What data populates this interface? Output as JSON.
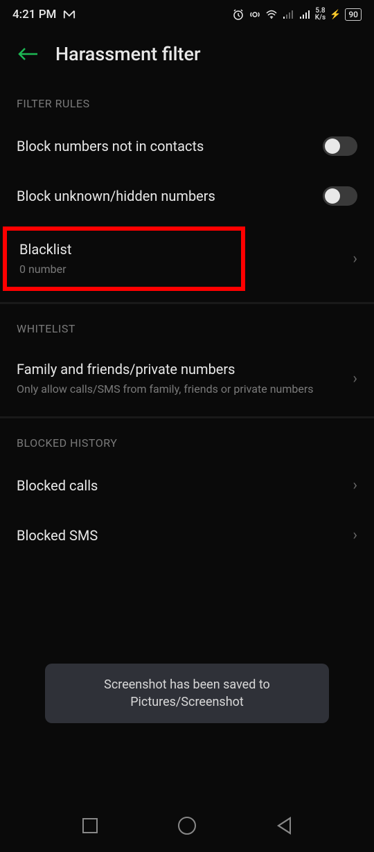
{
  "status_bar": {
    "time": "4:21 PM",
    "speed_value": "5.8",
    "speed_unit": "K/s",
    "battery": "90"
  },
  "header": {
    "title": "Harassment filter"
  },
  "sections": {
    "filter_rules": {
      "header": "FILTER RULES",
      "block_not_in_contacts": "Block numbers not in contacts",
      "block_unknown": "Block unknown/hidden numbers",
      "blacklist_title": "Blacklist",
      "blacklist_subtitle": "0 number"
    },
    "whitelist": {
      "header": "WHITELIST",
      "family_title": "Family and friends/private numbers",
      "family_subtitle": "Only allow calls/SMS from family, friends or private numbers"
    },
    "blocked_history": {
      "header": "BLOCKED HISTORY",
      "blocked_calls": "Blocked calls",
      "blocked_sms": "Blocked SMS"
    }
  },
  "toast": {
    "message": "Screenshot has been saved to  Pictures/Screenshot"
  }
}
